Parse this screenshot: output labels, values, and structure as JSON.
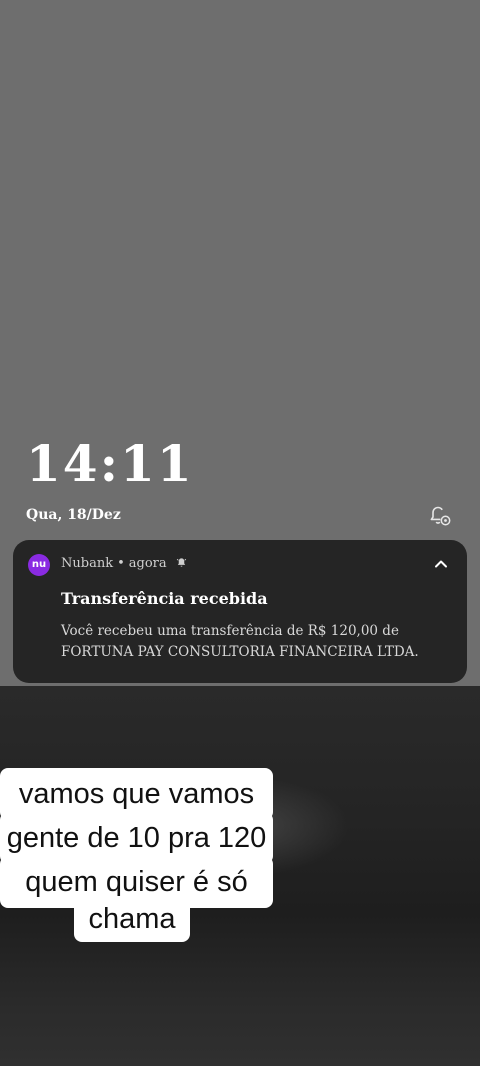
{
  "lockscreen": {
    "time": "14:11",
    "date": "Qua, 18/Dez",
    "notification_settings_icon": "bell-settings-icon"
  },
  "notification": {
    "app_name": "Nubank",
    "app_icon_text": "nu",
    "separator": "•",
    "time": "agora",
    "alert_icon": "alert-bell-icon",
    "expand_icon": "chevron-up-icon",
    "title": "Transferência recebida",
    "body": "Você recebeu uma transferência de R$ 120,00 de FORTUNA PAY CONSULTORIA FINANCEIRA LTDA.",
    "accent_color": "#8a2be2"
  },
  "caption": {
    "line1": "vamos que vamos",
    "line2": "gente  de 10 pra 120",
    "line3": "quem quiser é só",
    "line4": "chama"
  }
}
